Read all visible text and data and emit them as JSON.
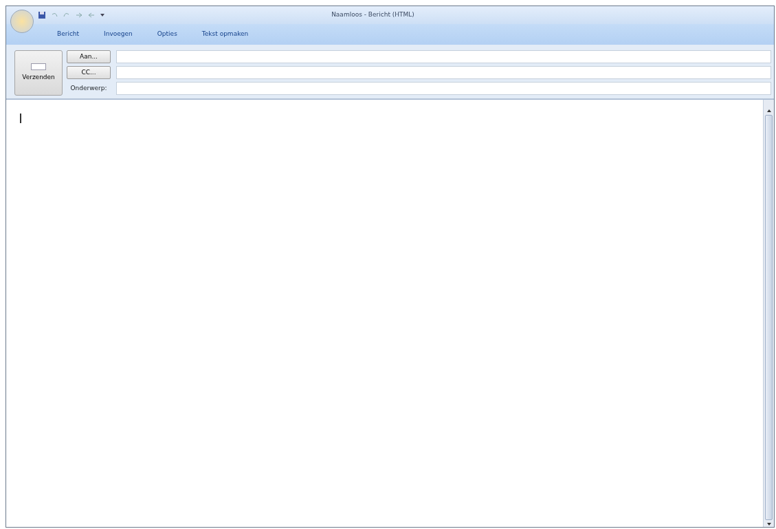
{
  "window": {
    "title": "Naamloos - Bericht (HTML)"
  },
  "tabs": [
    {
      "label": "Bericht",
      "selected": false
    },
    {
      "label": "Invoegen",
      "selected": false
    },
    {
      "label": "Opties",
      "selected": false
    },
    {
      "label": "Tekst opmaken",
      "selected": false
    }
  ],
  "send_button": {
    "label": "Verzenden"
  },
  "fields": [
    {
      "kind": "button",
      "label": "Aan..."
    },
    {
      "kind": "button",
      "label": "CC..."
    },
    {
      "kind": "label",
      "label": "Onderwerp:"
    }
  ]
}
